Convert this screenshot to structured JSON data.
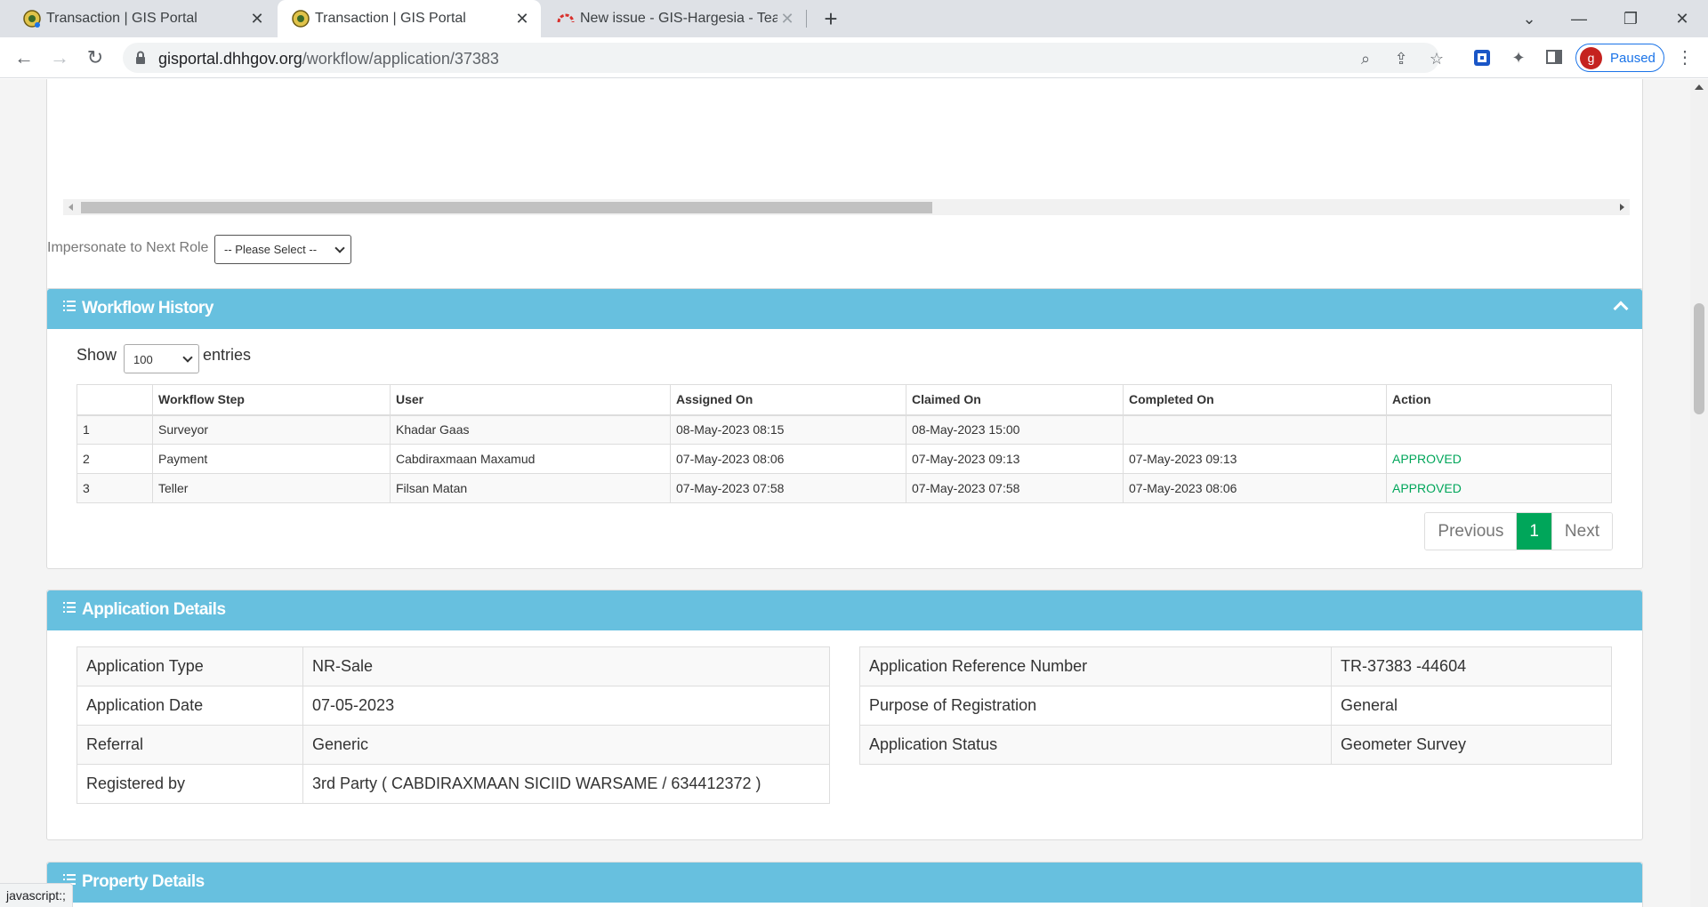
{
  "browser": {
    "tabs": [
      {
        "title": "Transaction | GIS Portal",
        "active": false
      },
      {
        "title": "Transaction | GIS Portal",
        "active": true
      },
      {
        "title": "New issue - GIS-Hargesia - Team",
        "active": false
      }
    ],
    "url_domain": "gisportal.dhhgov.org",
    "url_path": "/workflow/application/37383",
    "profile_initial": "g",
    "profile_status": "Paused"
  },
  "impersonate": {
    "label": "Impersonate to Next Role",
    "select_value": "-- Please Select --"
  },
  "workflow_history": {
    "title": "Workflow History",
    "show_label": "Show",
    "entries_value": "100",
    "entries_label": "entries",
    "columns": [
      "",
      "Workflow Step",
      "User",
      "Assigned On",
      "Claimed On",
      "Completed On",
      "Action"
    ],
    "rows": [
      [
        "1",
        "Surveyor",
        "Khadar Gaas",
        "08-May-2023 08:15",
        "08-May-2023 15:00",
        "",
        ""
      ],
      [
        "2",
        "Payment",
        "Cabdiraxmaan Maxamud",
        "07-May-2023 08:06",
        "07-May-2023 09:13",
        "07-May-2023 09:13",
        "APPROVED"
      ],
      [
        "3",
        "Teller",
        "Filsan Matan",
        "07-May-2023 07:58",
        "07-May-2023 07:58",
        "07-May-2023 08:06",
        "APPROVED"
      ]
    ],
    "pager": {
      "previous": "Previous",
      "current": "1",
      "next": "Next"
    }
  },
  "application_details": {
    "title": "Application Details",
    "left": [
      [
        "Application Type",
        "NR-Sale"
      ],
      [
        "Application Date",
        "07-05-2023"
      ],
      [
        "Referral",
        "Generic"
      ],
      [
        "Registered by",
        "3rd Party ( CABDIRAXMAAN SICIID WARSAME / 634412372 )"
      ]
    ],
    "right": [
      [
        "Application Reference Number",
        "TR-37383 -44604"
      ],
      [
        "Purpose of Registration",
        "General"
      ],
      [
        "Application Status",
        "Geometer Survey"
      ]
    ]
  },
  "property_details": {
    "title": "Property Details"
  },
  "status_bar": "javascript:;",
  "colors": {
    "panel_header": "#67c0df",
    "approved": "#00a65a",
    "pager_active": "#00a65a"
  }
}
